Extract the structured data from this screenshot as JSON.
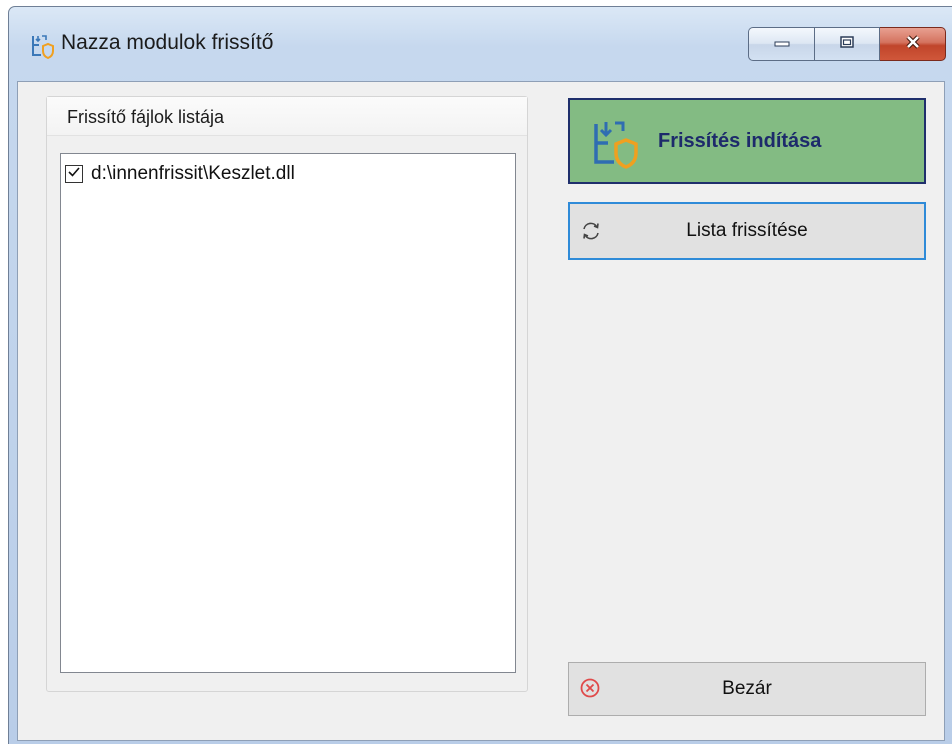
{
  "window": {
    "title": "Nazza modulok frissítő",
    "icons": {
      "app": "update-shield-icon",
      "minimize": "minimize-icon",
      "maximize": "maximize-icon",
      "close": "close-icon"
    },
    "colors": {
      "title_bar": "#c6d8ee",
      "close_button": "#c0452b"
    }
  },
  "file_list": {
    "title": "Frissítő fájlok listája",
    "items": [
      {
        "path": "d:\\innenfrissit\\Keszlet.dll",
        "checked": true
      }
    ]
  },
  "actions": {
    "start_update": {
      "label": "Frissítés indítása",
      "icon": "update-shield-icon",
      "background": "#83bb83",
      "text_color": "#1d2a6b"
    },
    "refresh_list": {
      "label": "Lista frissítése",
      "icon": "refresh-icon",
      "focused": true,
      "focus_color": "#2f8bd8"
    },
    "close": {
      "label": "Bezár",
      "icon": "cancel-circle-icon",
      "icon_color": "#e04a4a"
    }
  }
}
